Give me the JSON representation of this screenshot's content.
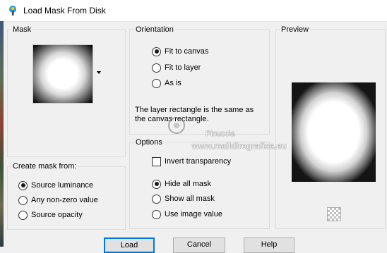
{
  "window": {
    "title": "Load Mask From Disk"
  },
  "mask": {
    "group_label": "Mask"
  },
  "create_mask_from": {
    "group_label": "Create mask from:",
    "options": [
      {
        "label": "Source luminance",
        "checked": true
      },
      {
        "label": "Any non-zero value",
        "checked": false
      },
      {
        "label": "Source opacity",
        "checked": false
      }
    ]
  },
  "orientation": {
    "group_label": "Orientation",
    "options": [
      {
        "label": "Fit to canvas",
        "checked": true
      },
      {
        "label": "Fit to layer",
        "checked": false
      },
      {
        "label": "As is",
        "checked": false
      }
    ],
    "info": "The layer rectangle is the same as the canvas rectangle."
  },
  "options": {
    "group_label": "Options",
    "invert_label": "Invert transparency",
    "invert_checked": false,
    "radio": [
      {
        "label": "Hide all mask",
        "checked": true
      },
      {
        "label": "Show all mask",
        "checked": false
      },
      {
        "label": "Use image value",
        "checked": false
      }
    ]
  },
  "preview": {
    "group_label": "Preview"
  },
  "watermark": {
    "name": "Pinuccia",
    "url": "www.maildiregrafica.eu"
  },
  "buttons": {
    "load": "Load",
    "cancel": "Cancel",
    "help": "Help"
  }
}
